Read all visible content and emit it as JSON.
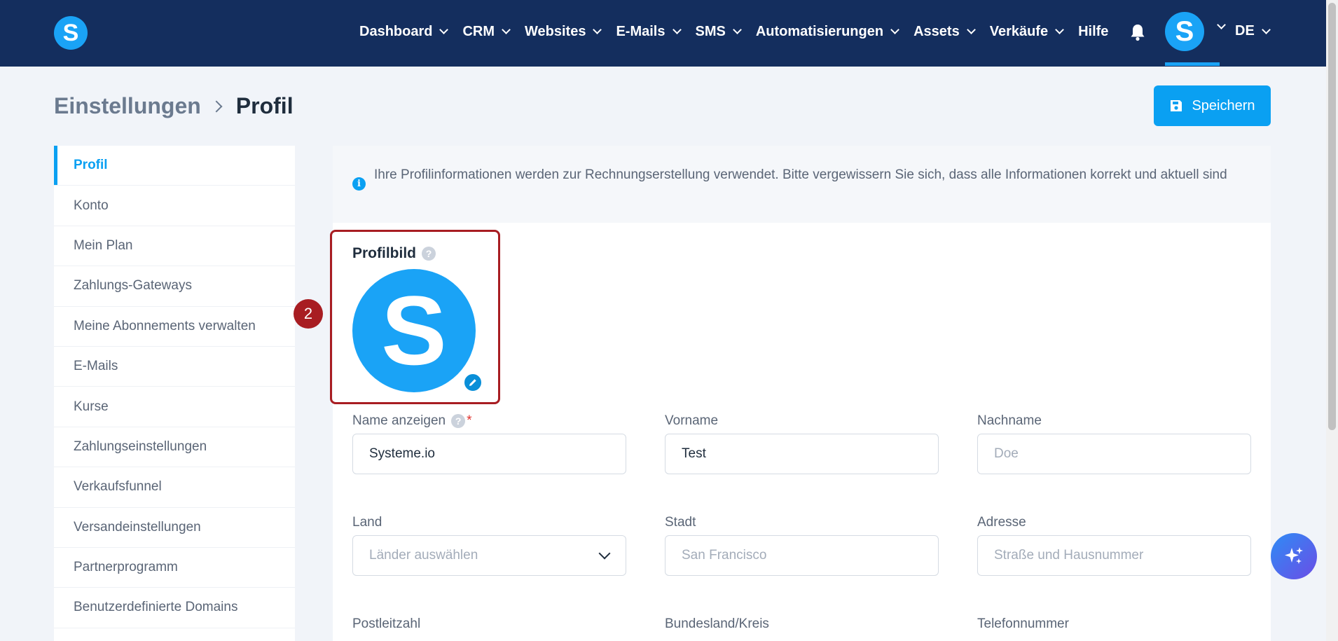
{
  "brand": {
    "logo_letter": "S",
    "accent": "#0aa0f2",
    "nav_bg": "#142e5e",
    "highlight": "#a81d22"
  },
  "nav": {
    "items": [
      {
        "label": "Dashboard",
        "has_dropdown": true
      },
      {
        "label": "CRM",
        "has_dropdown": true
      },
      {
        "label": "Websites",
        "has_dropdown": true
      },
      {
        "label": "E-Mails",
        "has_dropdown": true
      },
      {
        "label": "SMS",
        "has_dropdown": true
      },
      {
        "label": "Automatisierungen",
        "has_dropdown": true
      },
      {
        "label": "Assets",
        "has_dropdown": true
      },
      {
        "label": "Verkäufe",
        "has_dropdown": true
      },
      {
        "label": "Hilfe",
        "has_dropdown": false
      }
    ],
    "bell_icon": "bell-icon",
    "avatar_letter": "S",
    "language": "DE"
  },
  "header": {
    "breadcrumb_parent": "Einstellungen",
    "breadcrumb_current": "Profil",
    "save_label": "Speichern"
  },
  "sidebar": {
    "items": [
      {
        "label": "Profil",
        "active": true
      },
      {
        "label": "Konto"
      },
      {
        "label": "Mein Plan"
      },
      {
        "label": "Zahlungs-Gateways"
      },
      {
        "label": "Meine Abonnements verwalten"
      },
      {
        "label": "E-Mails"
      },
      {
        "label": "Kurse"
      },
      {
        "label": "Zahlungseinstellungen"
      },
      {
        "label": "Verkaufsfunnel"
      },
      {
        "label": "Versandeinstellungen"
      },
      {
        "label": "Partnerprogramm"
      },
      {
        "label": "Benutzerdefinierte Domains"
      }
    ]
  },
  "info": {
    "text": "Ihre Profilinformationen werden zur Rechnungserstellung verwendet. Bitte vergewissern Sie sich, dass alle Informationen korrekt und aktuell sind"
  },
  "profile_picture": {
    "label": "Profilbild",
    "letter": "S",
    "step_number": "2"
  },
  "fields": {
    "display_name": {
      "label": "Name anzeigen",
      "required_mark": "*",
      "value": "Systeme.io"
    },
    "first_name": {
      "label": "Vorname",
      "value": "Test"
    },
    "last_name": {
      "label": "Nachname",
      "placeholder": "Doe"
    },
    "country": {
      "label": "Land",
      "placeholder": "Länder auswählen"
    },
    "city": {
      "label": "Stadt",
      "placeholder": "San Francisco"
    },
    "address": {
      "label": "Adresse",
      "placeholder": "Straße und Hausnummer"
    },
    "postal_code": {
      "label": "Postleitzahl"
    },
    "state": {
      "label": "Bundesland/Kreis"
    },
    "phone": {
      "label": "Telefonnummer"
    }
  }
}
